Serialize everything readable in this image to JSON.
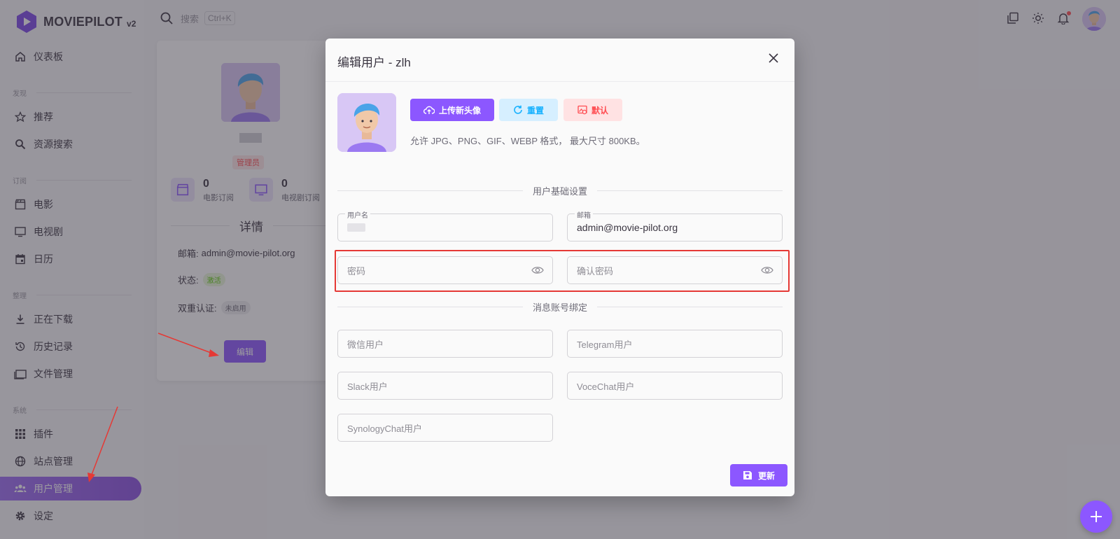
{
  "brand": {
    "name": "MOVIEPILOT",
    "version": "v2"
  },
  "search": {
    "placeholder": "搜索",
    "shortcut": "Ctrl+K"
  },
  "sidebar": {
    "items": [
      {
        "label": "仪表板"
      },
      {
        "section": "发现"
      },
      {
        "label": "推荐"
      },
      {
        "label": "资源搜索"
      },
      {
        "section": "订阅"
      },
      {
        "label": "电影"
      },
      {
        "label": "电视剧"
      },
      {
        "label": "日历"
      },
      {
        "section": "整理"
      },
      {
        "label": "正在下载"
      },
      {
        "label": "历史记录"
      },
      {
        "label": "文件管理"
      },
      {
        "section": "系统"
      },
      {
        "label": "插件"
      },
      {
        "label": "站点管理"
      },
      {
        "label": "用户管理",
        "active": true
      },
      {
        "label": "设定"
      }
    ]
  },
  "profile_card": {
    "role": "管理员",
    "stats": [
      {
        "value": "0",
        "label": "电影订阅"
      },
      {
        "value": "0",
        "label": "电视剧订阅"
      }
    ],
    "detail_title": "详情",
    "email_label": "邮箱:",
    "email": "admin@movie-pilot.org",
    "status_label": "状态:",
    "status": "激活",
    "twofa_label": "双重认证:",
    "twofa": "未启用",
    "edit_label": "编辑"
  },
  "modal": {
    "title": "编辑用户 - zlh",
    "upload_label": "上传新头像",
    "reset_label": "重置",
    "default_label": "默认",
    "hint": "允许 JPG、PNG、GIF、WEBP 格式， 最大尺寸 800KB。",
    "section_basic": "用户基础设置",
    "username_label": "用户名",
    "email_label": "邮箱",
    "email_value": "admin@movie-pilot.org",
    "password_placeholder": "密码",
    "confirm_password_placeholder": "确认密码",
    "section_binding": "消息账号绑定",
    "wechat_placeholder": "微信用户",
    "telegram_placeholder": "Telegram用户",
    "slack_placeholder": "Slack用户",
    "vocechat_placeholder": "VoceChat用户",
    "synology_placeholder": "SynologyChat用户",
    "save_label": "更新"
  },
  "colors": {
    "primary": "#8c57ff",
    "info": "#16b1ff",
    "error": "#ff4c51",
    "annotation": "#e53935"
  }
}
